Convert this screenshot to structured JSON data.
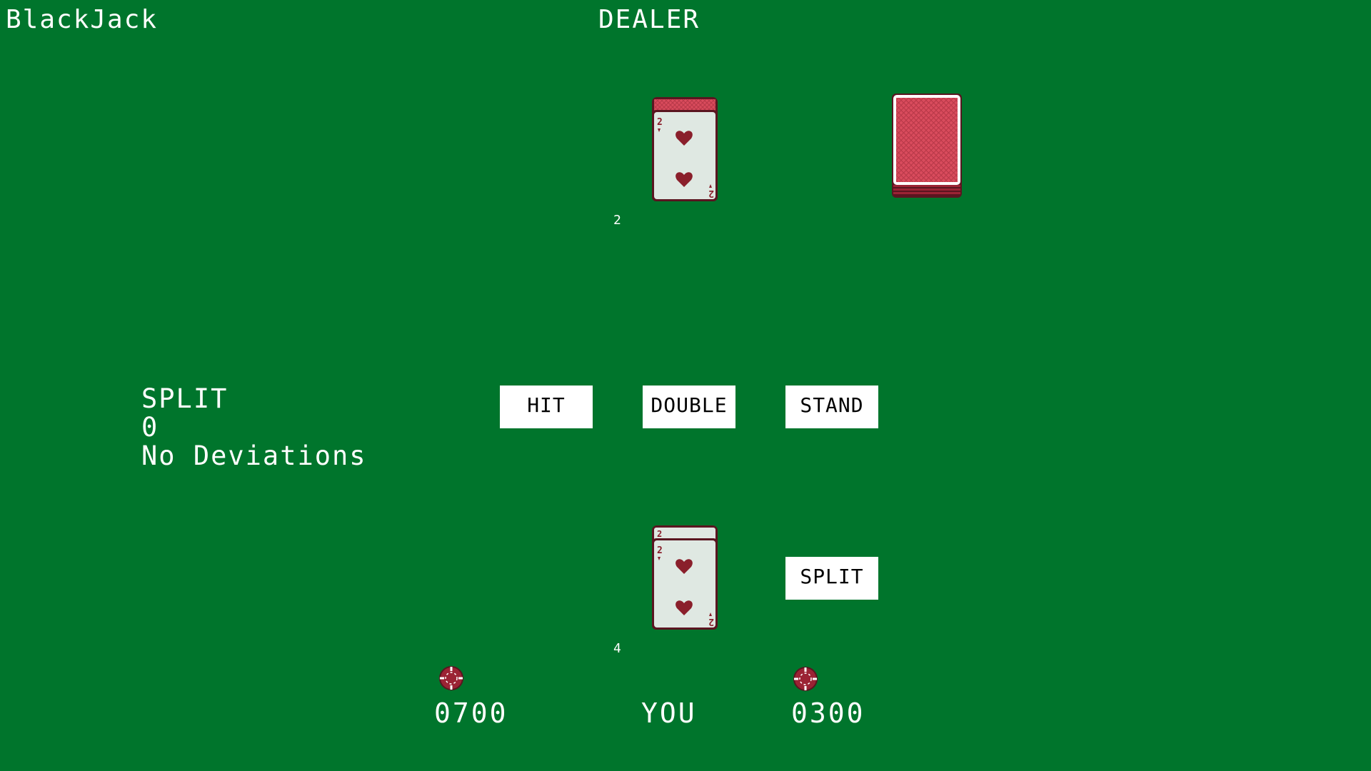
{
  "app": {
    "title": "BlackJack"
  },
  "dealer": {
    "title": "DEALER",
    "hand_value": "2",
    "cards": [
      {
        "rank": "2",
        "suit": "hearts-icon",
        "face_up": true
      },
      {
        "rank": "",
        "suit": "",
        "face_up": false
      }
    ]
  },
  "strategy": {
    "action": "SPLIT",
    "count": "0",
    "deviation": "No Deviations"
  },
  "actions": {
    "hit_label": "HIT",
    "double_label": "DOUBLE",
    "stand_label": "STAND",
    "split_label": "SPLIT"
  },
  "player": {
    "label": "YOU",
    "hand_value": "4",
    "cards": [
      {
        "rank": "2",
        "suit": "hearts-icon"
      },
      {
        "rank": "2",
        "suit": "hearts-icon"
      }
    ],
    "bankroll": "0700",
    "bet": "0300"
  },
  "colors": {
    "table": "#00752c",
    "card_face": "#dfe8e2",
    "card_back": "#d94b5c",
    "suit_red": "#8a1f2b",
    "chip": "#9b2334"
  }
}
